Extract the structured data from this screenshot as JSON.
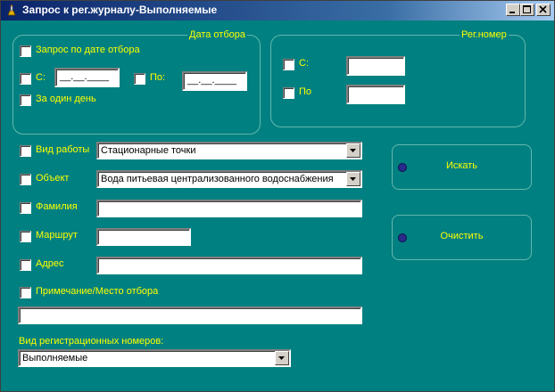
{
  "window": {
    "title": "Запрос к рег.журналу-Выполняемые",
    "icon": "lamp-icon"
  },
  "date_group": {
    "legend": "Дата отбора",
    "by_date_label": "Запрос по дате отбора",
    "from_label": "С:",
    "from_value": "__.__.____",
    "to_label": "По:",
    "to_value": "__.__.____",
    "one_day_label": "За один день"
  },
  "reg_group": {
    "legend": "Рег.номер",
    "from_label": "С:",
    "from_value": "",
    "to_label": "По",
    "to_value": ""
  },
  "fields": {
    "work_type_label": "Вид работы",
    "work_type_value": "Стационарные точки",
    "object_label": "Объект",
    "object_value": "Вода  питьевая централизованного водоснабжения",
    "surname_label": "Фамилия",
    "surname_value": "",
    "route_label": "Маршрут",
    "route_value": "",
    "address_label": "Адрес",
    "address_value": "",
    "note_label": "Примечание/Место отбора",
    "note_value": ""
  },
  "regnum_type": {
    "label": "Вид регистрационных номеров:",
    "value": "Выполняемые"
  },
  "buttons": {
    "search_label": "Искать",
    "clear_label": "Очистить"
  },
  "colors": {
    "background": "#008080",
    "label": "#ffff00",
    "title_bar": "#0a246a"
  }
}
